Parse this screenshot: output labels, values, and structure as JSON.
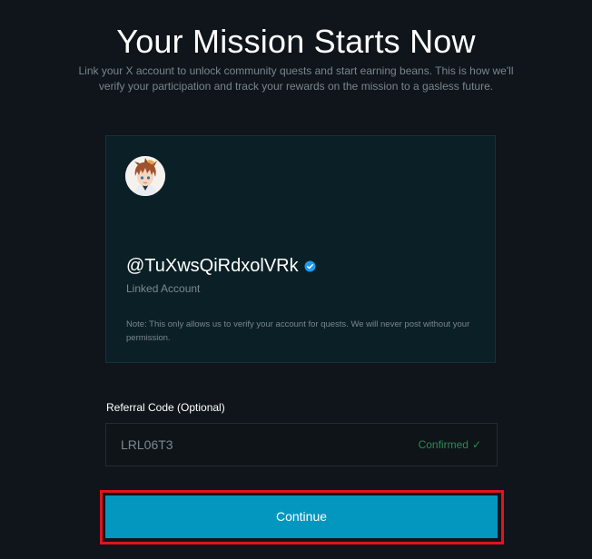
{
  "page": {
    "title": "Your Mission Starts Now",
    "subtitle": "Link your X account to unlock community quests and start earning beans. This is how we'll verify your participation and track your rewards on the mission to a gasless future."
  },
  "account": {
    "handle": "@TuXwsQiRdxolVRk",
    "verified_icon": "verified-badge-icon",
    "linked_label": "Linked Account",
    "note": "Note: This only allows us to verify your account for quests. We will never post without your permission."
  },
  "referral": {
    "label": "Referral Code (Optional)",
    "value": "LRL06T3",
    "status": "Confirmed",
    "status_icon": "check-icon",
    "status_glyph": "✓"
  },
  "actions": {
    "continue_label": "Continue"
  },
  "colors": {
    "background": "#0f151a",
    "card": "#0b2026",
    "accent": "#0397bf",
    "confirmed": "#2e8a55",
    "highlight": "#e1141b",
    "verified": "#1d9bf0"
  }
}
